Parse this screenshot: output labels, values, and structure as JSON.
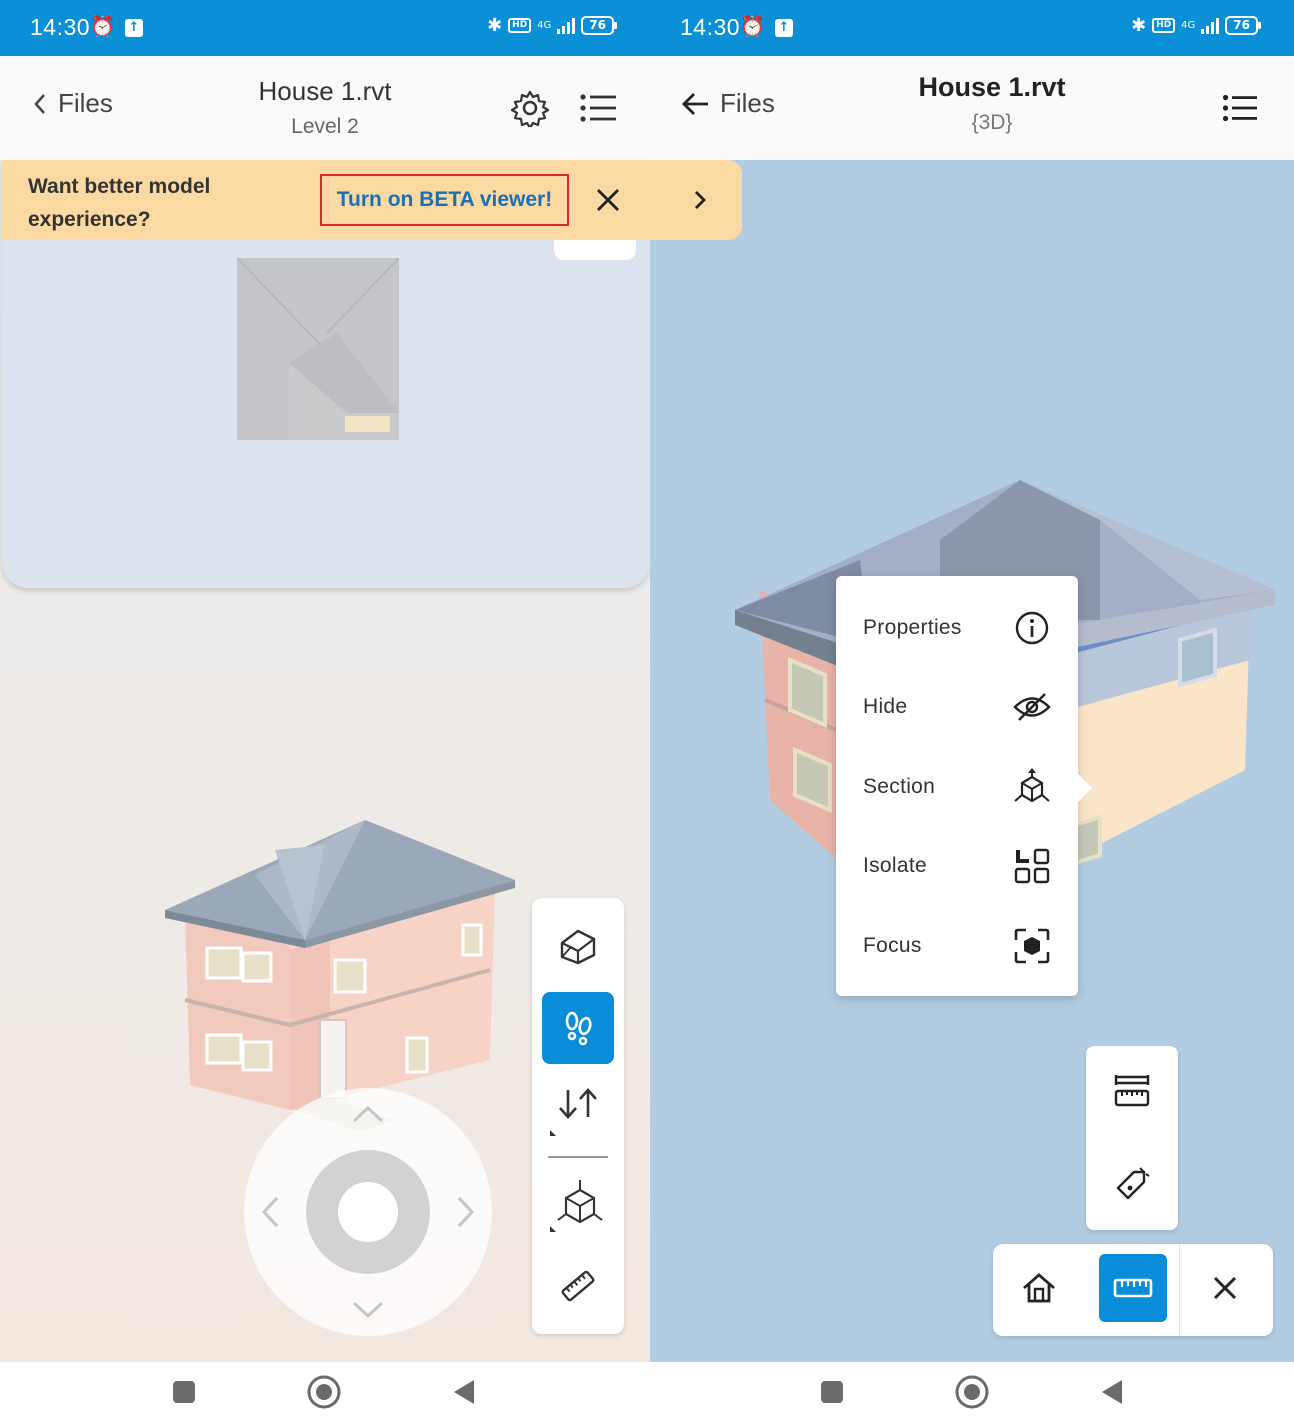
{
  "status": {
    "time": "14:30",
    "network": "4G",
    "battery": "76"
  },
  "left": {
    "header": {
      "back_label": "Files",
      "title": "House 1.rvt",
      "subtitle": "Level 2"
    },
    "banner": {
      "text": "Want better model experience?",
      "link": "Turn on BETA viewer!"
    },
    "toolbar": [
      "3d-view",
      "walk-mode (active)",
      "up-down",
      "section-box",
      "measure"
    ],
    "joystick": [
      "up",
      "left",
      "right",
      "down"
    ]
  },
  "right": {
    "header": {
      "back_label": "Files",
      "title": "House 1.rvt",
      "subtitle": "{3D}"
    },
    "context_menu": [
      {
        "label": "Properties",
        "icon": "info-icon"
      },
      {
        "label": "Hide",
        "icon": "eye-off-icon"
      },
      {
        "label": "Section",
        "icon": "section-icon"
      },
      {
        "label": "Isolate",
        "icon": "isolate-icon"
      },
      {
        "label": "Focus",
        "icon": "focus-icon"
      }
    ],
    "bottom_toolbar": [
      "home-icon",
      "ruler-icon (active)",
      "close-icon"
    ]
  },
  "colors": {
    "status_bar": "#0b8fd6",
    "accent": "#0a8dd8",
    "banner": "#fbd9a3",
    "banner_link": "#1a6fb5",
    "viewer_bg_right": "#b2cce2"
  }
}
